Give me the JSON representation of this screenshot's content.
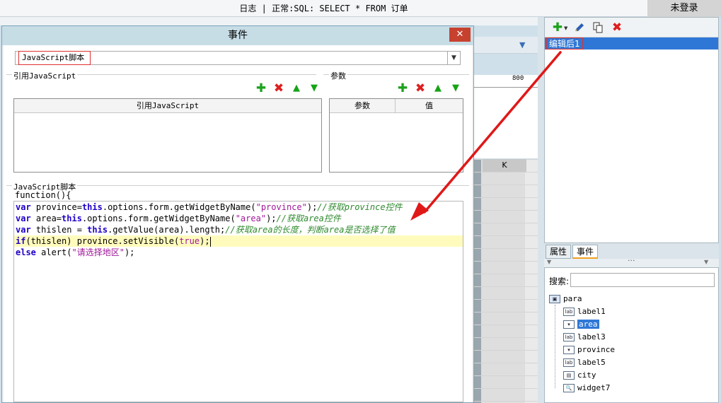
{
  "titlebar": {
    "title": "日志 | 正常:SQL: SELECT * FROM 订单",
    "login": "未登录"
  },
  "background": {
    "ruler_label": "800",
    "column_header": "K"
  },
  "dialog": {
    "title": "事件",
    "close_glyph": "✕",
    "script_type": "JavaScript脚本",
    "referenced_group_label": "引用JavaScript",
    "params_group_label": "参数",
    "referenced_table_header": "引用JavaScript",
    "params_table_headers": [
      "参数",
      "值"
    ],
    "script_group_label": "JavaScript脚本",
    "function_header": "function(){",
    "code_lines": [
      [
        {
          "t": "var",
          "c": "kw"
        },
        {
          "t": " province="
        },
        {
          "t": "this",
          "c": "kw"
        },
        {
          "t": ".options.form.getWidgetByName("
        },
        {
          "t": "\"province\"",
          "c": "str"
        },
        {
          "t": ");"
        },
        {
          "t": "//获取province控件",
          "c": "cm"
        }
      ],
      [
        {
          "t": "var",
          "c": "kw"
        },
        {
          "t": " area="
        },
        {
          "t": "this",
          "c": "kw"
        },
        {
          "t": ".options.form.getWidgetByName("
        },
        {
          "t": "\"area\"",
          "c": "str"
        },
        {
          "t": ");"
        },
        {
          "t": "//获取area控件",
          "c": "cm"
        }
      ],
      [
        {
          "t": "var",
          "c": "kw"
        },
        {
          "t": " thislen = "
        },
        {
          "t": "this",
          "c": "kw"
        },
        {
          "t": ".getValue(area).length;"
        },
        {
          "t": "//获取area的长度，判断area是否选择了值",
          "c": "cm"
        }
      ],
      [
        {
          "t": "if",
          "c": "kw"
        },
        {
          "t": "(thislen) province.setVisible("
        },
        {
          "t": "true",
          "c": "str"
        },
        {
          "t": ");"
        }
      ],
      [
        {
          "t": "else",
          "c": "kw"
        },
        {
          "t": " alert("
        },
        {
          "t": "\"请选择地区\"",
          "c": "str"
        },
        {
          "t": ");"
        }
      ]
    ]
  },
  "right_panel": {
    "selected_event": "编辑后1",
    "tabs": [
      "属性",
      "事件"
    ],
    "splitter_glyph": "···",
    "search_label": "搜索:",
    "search_value": "",
    "tree": {
      "root": "para",
      "children": [
        {
          "name": "label1",
          "icon": "label-widget-icon",
          "badge": "lab"
        },
        {
          "name": "area",
          "icon": "combo-widget-icon",
          "badge": "▾",
          "selected": true
        },
        {
          "name": "label3",
          "icon": "label-widget-icon",
          "badge": "lab"
        },
        {
          "name": "province",
          "icon": "combo-widget-icon",
          "badge": "▾"
        },
        {
          "name": "label5",
          "icon": "label-widget-icon",
          "badge": "lab"
        },
        {
          "name": "city",
          "icon": "tree-combo-widget-icon",
          "badge": "▤"
        },
        {
          "name": "widget7",
          "icon": "search-widget-icon",
          "badge": "🔍"
        }
      ]
    }
  },
  "colors": {
    "accent": "#2f77d6",
    "close": "#c7412f",
    "annotation": "#e01818",
    "add": "#1da21d",
    "delete": "#dd1f1f"
  }
}
